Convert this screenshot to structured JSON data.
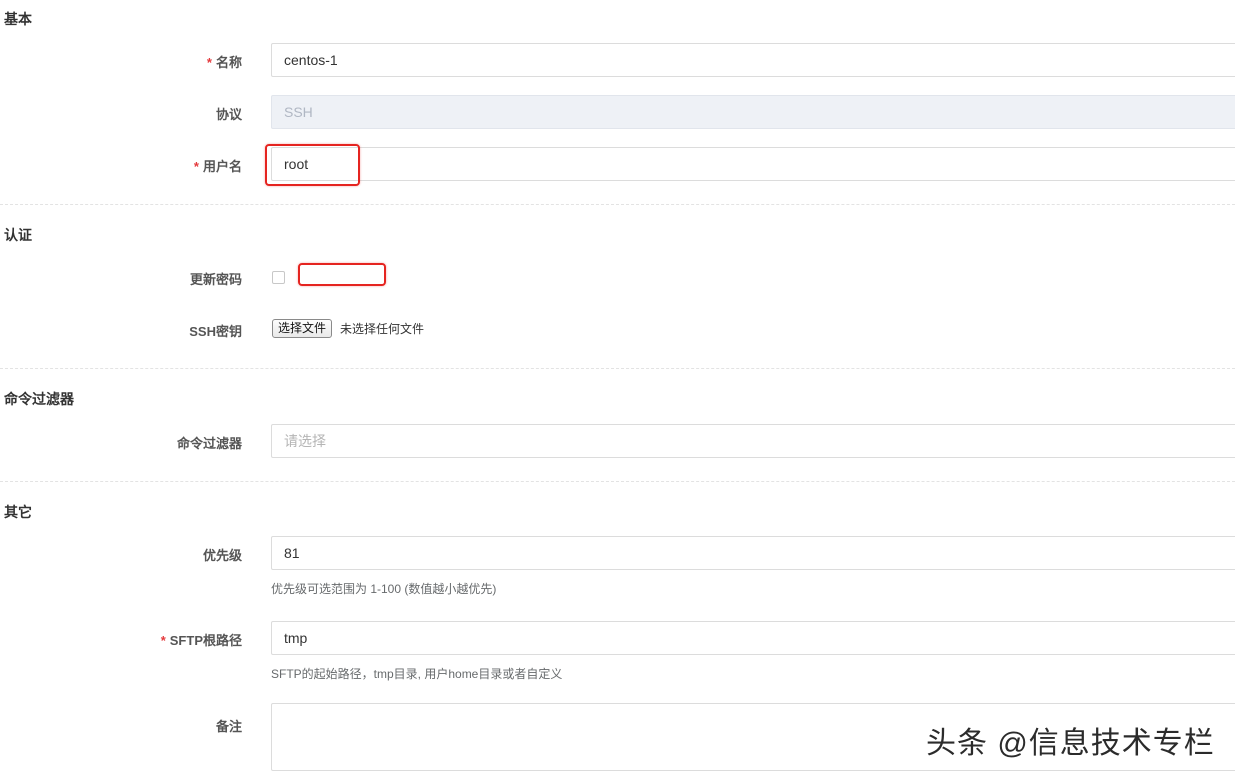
{
  "sections": {
    "basic": "基本",
    "auth": "认证",
    "command_filter": "命令过滤器",
    "other": "其它"
  },
  "required_mark": "*",
  "fields": {
    "name": {
      "label": "名称",
      "value": "centos-1"
    },
    "protocol": {
      "label": "协议",
      "value": "SSH"
    },
    "username": {
      "label": "用户名",
      "value": "root"
    },
    "update_password": {
      "label": "更新密码"
    },
    "ssh_key": {
      "label": "SSH密钥",
      "button": "选择文件",
      "status": "未选择任何文件"
    },
    "command_filter": {
      "label": "命令过滤器",
      "placeholder": "请选择"
    },
    "priority": {
      "label": "优先级",
      "value": "81",
      "help": "优先级可选范围为 1-100 (数值越小越优先)"
    },
    "sftp_root": {
      "label": "SFTP根路径",
      "value": "tmp",
      "help": "SFTP的起始路径，tmp目录, 用户home目录或者自定义"
    },
    "comment": {
      "label": "备注",
      "value": ""
    }
  },
  "watermark": "头条 @信息技术专栏",
  "colors": {
    "required": "#e4393c",
    "highlight": "#e52420",
    "disabled_bg": "#eef1f6"
  }
}
